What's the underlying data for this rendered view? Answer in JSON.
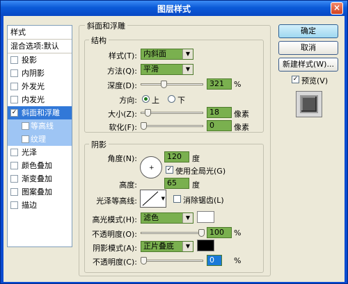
{
  "window": {
    "title": "图层样式",
    "close": "×"
  },
  "styles": {
    "header": "样式",
    "blend": "混合选项:默认",
    "items": [
      {
        "label": "投影",
        "checked": false
      },
      {
        "label": "内阴影",
        "checked": false
      },
      {
        "label": "外发光",
        "checked": false
      },
      {
        "label": "内发光",
        "checked": false
      },
      {
        "label": "斜面和浮雕",
        "checked": true
      },
      {
        "label": "等高线",
        "checked": false
      },
      {
        "label": "纹理",
        "checked": false
      },
      {
        "label": "光泽",
        "checked": false
      },
      {
        "label": "颜色叠加",
        "checked": false
      },
      {
        "label": "渐变叠加",
        "checked": false
      },
      {
        "label": "图案叠加",
        "checked": false
      },
      {
        "label": "描边",
        "checked": false
      }
    ]
  },
  "bevel": {
    "group_title": "斜面和浮雕",
    "structure_title": "结构",
    "style_label": "样式(T):",
    "style_value": "内斜面",
    "method_label": "方法(Q):",
    "method_value": "平滑",
    "depth_label": "深度(D):",
    "depth_value": "321",
    "depth_unit": "%",
    "direction_label": "方向:",
    "dir_up": "上",
    "dir_down": "下",
    "size_label": "大小(Z):",
    "size_value": "18",
    "size_unit": "像素",
    "soften_label": "软化(F):",
    "soften_value": "0",
    "soften_unit": "像素"
  },
  "shading": {
    "title": "阴影",
    "angle_label": "角度(N):",
    "angle_value": "120",
    "angle_unit": "度",
    "global_light": "使用全局光(G)",
    "altitude_label": "高度:",
    "altitude_value": "65",
    "altitude_unit": "度",
    "gloss_label": "光泽等高线:",
    "anti_alias": "消除锯齿(L)",
    "highlight_mode_label": "高光模式(H):",
    "highlight_mode": "滤色",
    "highlight_color": "#ffffff",
    "opacity_label": "不透明度(O):",
    "highlight_opacity": "100",
    "pct": "%",
    "shadow_mode_label": "阴影模式(A):",
    "shadow_mode": "正片叠底",
    "shadow_color": "#000000",
    "shadow_opacity_label": "不透明度(C):",
    "shadow_opacity": "0"
  },
  "buttons": {
    "ok": "确定",
    "cancel": "取消",
    "new_style": "新建样式(W)...",
    "preview": "预览(V)"
  }
}
